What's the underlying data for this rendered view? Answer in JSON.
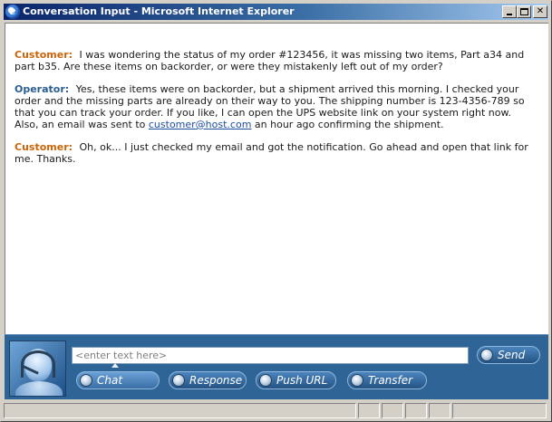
{
  "window": {
    "title": "Conversation Input - Microsoft Internet Explorer",
    "icon": "internet-explorer-icon",
    "controls": [
      "minimize",
      "maximize",
      "close"
    ]
  },
  "conversation": [
    {
      "speaker": "Customer:",
      "role": "customer",
      "text": "I was wondering the status of my order #123456, it was missing two items, Part a34 and part b35.    Are these items on backorder, or were they mistakenly left out of my order?"
    },
    {
      "speaker": "Operator:",
      "role": "operator",
      "text_before": "Yes, these items were on backorder, but a shipment arrived this morning.   I checked your order and the missing parts are already on their way to you.   The shipping number is 123-4356-789 so that you can track your order.   If you like, I can open the UPS website link on your system right now.   Also, an email was sent to ",
      "link": "customer@host.com",
      "text_after": " an hour ago confirming the shipment."
    },
    {
      "speaker": "Customer:",
      "role": "customer",
      "text": "Oh, ok... I just checked my email and got the notification.  Go ahead and open that link for me.   Thanks."
    }
  ],
  "input": {
    "placeholder": "<enter text here>",
    "value": ""
  },
  "buttons": {
    "send": "Send",
    "chat": "Chat",
    "response": "Response",
    "push_url": "Push URL",
    "transfer": "Transfer"
  },
  "selected_mode": "Chat",
  "colors": {
    "customer": "#c8650a",
    "operator": "#2c5d8f",
    "panel": "#2f6496",
    "titlebar": "#0a246a"
  }
}
